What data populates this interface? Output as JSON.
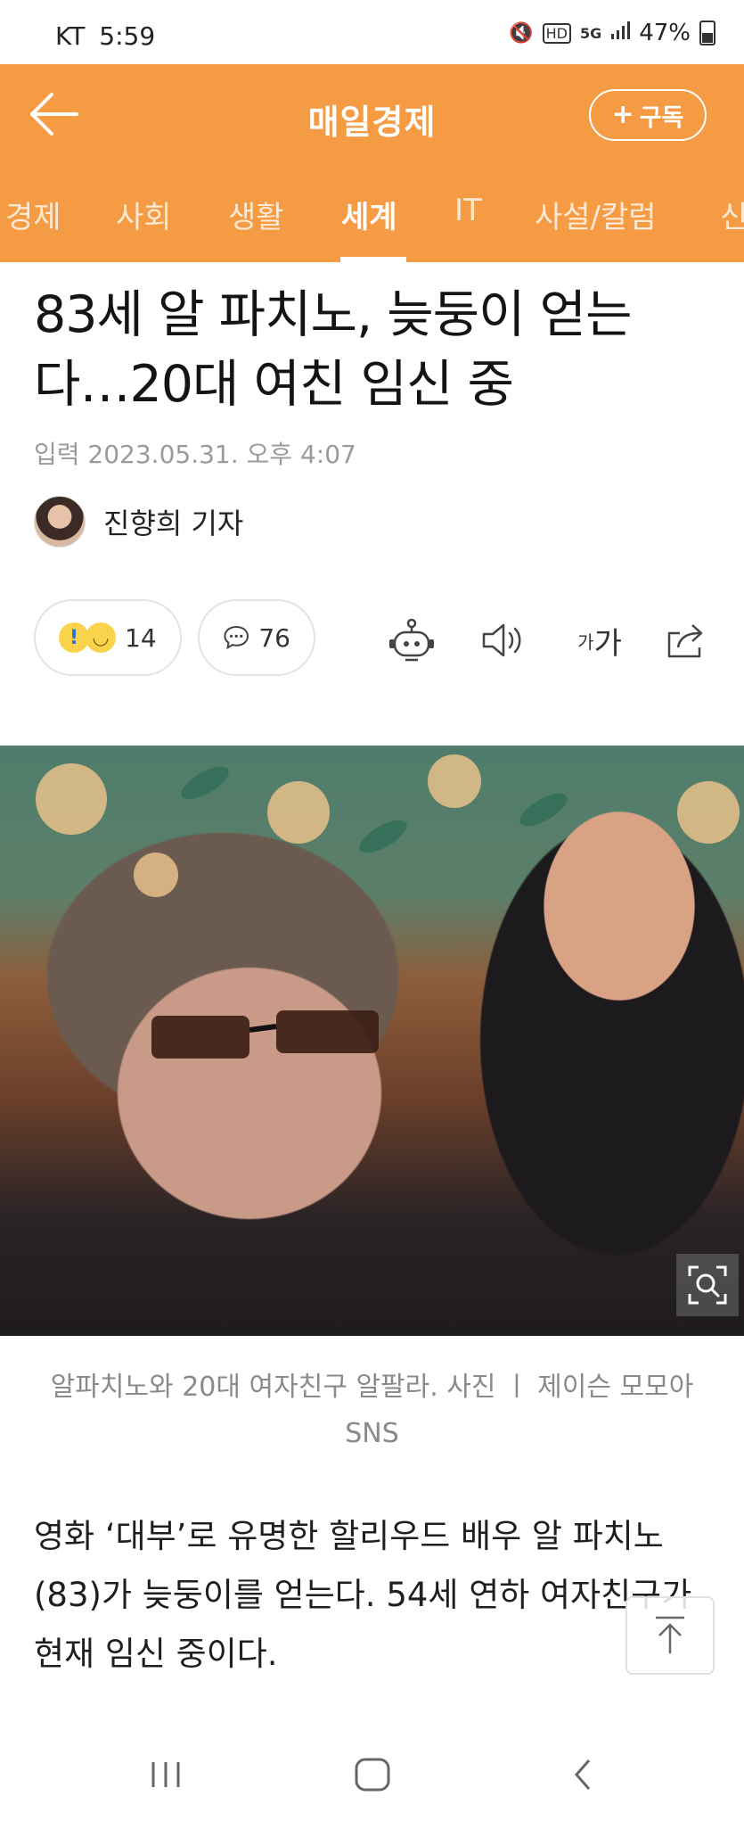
{
  "status_bar": {
    "carrier": "KT",
    "time": "5:59",
    "icons": [
      "mute-icon",
      "hd-icon",
      "5g-icon",
      "signal-icon"
    ],
    "battery": "47%"
  },
  "header": {
    "title": "매일경제",
    "subscribe_label": "구독",
    "accent_color": "#f59b43"
  },
  "tabs": [
    {
      "label": "경제"
    },
    {
      "label": "사회"
    },
    {
      "label": "생활"
    },
    {
      "label": "세계",
      "active": true
    },
    {
      "label": "IT"
    },
    {
      "label": "사설/칼럼"
    },
    {
      "label": "신"
    }
  ],
  "article": {
    "headline": "83세 알 파치노, 늦둥이 얻는다…20대 여친 임신 중",
    "date": "입력 2023.05.31. 오후 4:07",
    "author": "진향희 기자",
    "reactions_count": "14",
    "comments_count": "76",
    "font_size_label_small": "가",
    "font_size_label_large": "가",
    "photo_caption": "알파치노와 20대 여자친구 알팔라. 사진 ㅣ 제이슨 모모아 SNS",
    "body": "영화 ‘대부’로 유명한 할리우드 배우 알 파치노(83)가 늦둥이를 얻는다. 54세 연하 여자친구가 현재 임신 중이다."
  }
}
